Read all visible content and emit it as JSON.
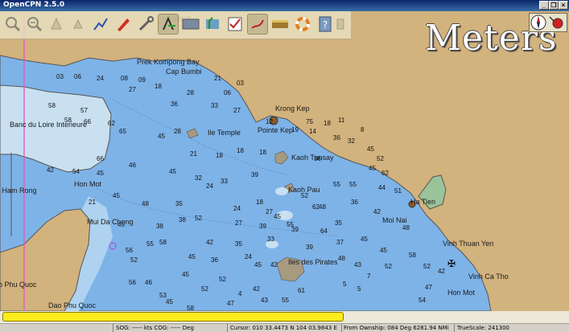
{
  "window": {
    "title": "OpenCPN 2.5.0"
  },
  "chart": {
    "units_label": "Meters",
    "place_names": [
      {
        "text": "Prek Kompong Bay"
      },
      {
        "text": "Cap Bumbi"
      },
      {
        "text": "Cairpot"
      },
      {
        "text": "Banc du Loire Interieure"
      },
      {
        "text": "Ile Temple"
      },
      {
        "text": "Krong Kep"
      },
      {
        "text": "Pointe Kep"
      },
      {
        "text": "Kaoh Tunsay"
      },
      {
        "text": "Hon Mot"
      },
      {
        "text": "Kaoh Pau"
      },
      {
        "text": "Ha Tien"
      },
      {
        "text": "Moi Nai"
      },
      {
        "text": "i Ham Rong"
      },
      {
        "text": "Mui Da Chong"
      },
      {
        "text": "Vinh Thuan Yen"
      },
      {
        "text": "Iles des Pirates"
      },
      {
        "text": "Vinh Ca Tho"
      },
      {
        "text": "Hon Mot"
      },
      {
        "text": "o Phu Quoc"
      },
      {
        "text": "Dao Phu Quoc"
      }
    ],
    "soundings": [
      {
        "t": "03"
      },
      {
        "t": "06"
      },
      {
        "t": "24"
      },
      {
        "t": "08"
      },
      {
        "t": "09"
      },
      {
        "t": "21"
      },
      {
        "t": "03"
      },
      {
        "t": "58"
      },
      {
        "t": "66"
      },
      {
        "t": "62"
      },
      {
        "t": "27"
      },
      {
        "t": "18"
      },
      {
        "t": "28"
      },
      {
        "t": "06"
      },
      {
        "t": "57"
      },
      {
        "t": "58"
      },
      {
        "t": "65"
      },
      {
        "t": "45"
      },
      {
        "t": "27"
      },
      {
        "t": "33"
      },
      {
        "t": "36"
      },
      {
        "t": "42"
      },
      {
        "t": "54"
      },
      {
        "t": "45"
      },
      {
        "t": "28"
      },
      {
        "t": "21"
      },
      {
        "t": "18"
      },
      {
        "t": "18"
      },
      {
        "t": "18"
      },
      {
        "t": "46"
      },
      {
        "t": "45"
      },
      {
        "t": "32"
      },
      {
        "t": "33"
      },
      {
        "t": "39"
      },
      {
        "t": "36"
      },
      {
        "t": "45"
      },
      {
        "t": "48"
      },
      {
        "t": "35"
      },
      {
        "t": "24"
      },
      {
        "t": "24"
      },
      {
        "t": "18"
      },
      {
        "t": "27"
      },
      {
        "t": "45"
      },
      {
        "t": "38"
      },
      {
        "t": "38"
      },
      {
        "t": "42"
      },
      {
        "t": "27"
      },
      {
        "t": "39"
      },
      {
        "t": "39"
      },
      {
        "t": "55"
      },
      {
        "t": "56"
      },
      {
        "t": "45"
      },
      {
        "t": "36"
      },
      {
        "t": "35"
      },
      {
        "t": "24"
      },
      {
        "t": "33"
      },
      {
        "t": "39"
      },
      {
        "t": "37"
      },
      {
        "t": "48"
      },
      {
        "t": "35"
      },
      {
        "t": "36"
      },
      {
        "t": "45"
      },
      {
        "t": "42"
      },
      {
        "t": "55"
      },
      {
        "t": "55"
      },
      {
        "t": "45"
      },
      {
        "t": "44"
      },
      {
        "t": "51"
      },
      {
        "t": "48"
      },
      {
        "t": "45"
      },
      {
        "t": "52"
      },
      {
        "t": "58"
      },
      {
        "t": "52"
      },
      {
        "t": "42"
      },
      {
        "t": "47"
      },
      {
        "t": "54"
      },
      {
        "t": "5"
      },
      {
        "t": "45"
      },
      {
        "t": "55"
      },
      {
        "t": "52"
      },
      {
        "t": "62"
      },
      {
        "t": "64"
      },
      {
        "t": "48"
      },
      {
        "t": "43"
      },
      {
        "t": "45"
      },
      {
        "t": "52"
      },
      {
        "t": "52"
      },
      {
        "t": "4"
      },
      {
        "t": "42"
      },
      {
        "t": "47"
      },
      {
        "t": "61"
      },
      {
        "t": "45"
      },
      {
        "t": "58"
      },
      {
        "t": "53"
      },
      {
        "t": "43"
      },
      {
        "t": "55"
      },
      {
        "t": "5"
      },
      {
        "t": "7"
      },
      {
        "t": "46"
      },
      {
        "t": "56"
      },
      {
        "t": "52"
      },
      {
        "t": "58"
      },
      {
        "t": "52"
      },
      {
        "t": "45"
      },
      {
        "t": "42"
      },
      {
        "t": "66"
      },
      {
        "t": "75"
      },
      {
        "t": "36"
      },
      {
        "t": "32"
      },
      {
        "t": "45"
      },
      {
        "t": "52"
      },
      {
        "t": "62"
      },
      {
        "t": "12"
      },
      {
        "t": "19"
      },
      {
        "t": "14"
      },
      {
        "t": "18"
      },
      {
        "t": "11"
      },
      {
        "t": "8"
      },
      {
        "t": "21"
      }
    ]
  },
  "toolbar": {
    "buttons": [
      {
        "name": "zoom-in-button",
        "icon": "zoom-in-icon"
      },
      {
        "name": "zoom-out-button",
        "icon": "zoom-out-icon"
      },
      {
        "name": "scale-in-button",
        "icon": "scale-in-icon"
      },
      {
        "name": "scale-out-button",
        "icon": "scale-out-icon"
      },
      {
        "name": "route-button",
        "icon": "route-icon"
      },
      {
        "name": "track-button",
        "icon": "track-icon"
      },
      {
        "name": "settings-button",
        "icon": "wrench-icon"
      },
      {
        "name": "follow-button",
        "icon": "follow-ship-icon"
      },
      {
        "name": "text-button",
        "icon": "text-icon"
      },
      {
        "name": "current-button",
        "icon": "current-icon"
      },
      {
        "name": "tide-button",
        "icon": "tide-icon"
      },
      {
        "name": "print-button",
        "icon": "print-icon"
      },
      {
        "name": "route-manager-button",
        "icon": "route-manager-icon"
      },
      {
        "name": "ais-button",
        "icon": "ais-icon"
      },
      {
        "name": "help-button",
        "icon": "help-icon"
      },
      {
        "name": "mob-button",
        "icon": "life-ring-icon"
      }
    ]
  },
  "status": {
    "sog": "SOG: ----- kts  COG: ----- Deg",
    "cursor": "Cursor: 010 33.4473 N 104 03.9843 E",
    "from_ownship": "From Ownship: 084 Deg  6281.94 NMi",
    "truescale": "TrueScale:    241300"
  },
  "colors": {
    "land": "#d2b27d",
    "shallow": "#c8e0f0",
    "deep": "#7eb3e8",
    "toolbar": "#e9e1c1",
    "progress": "#ffec1c"
  }
}
